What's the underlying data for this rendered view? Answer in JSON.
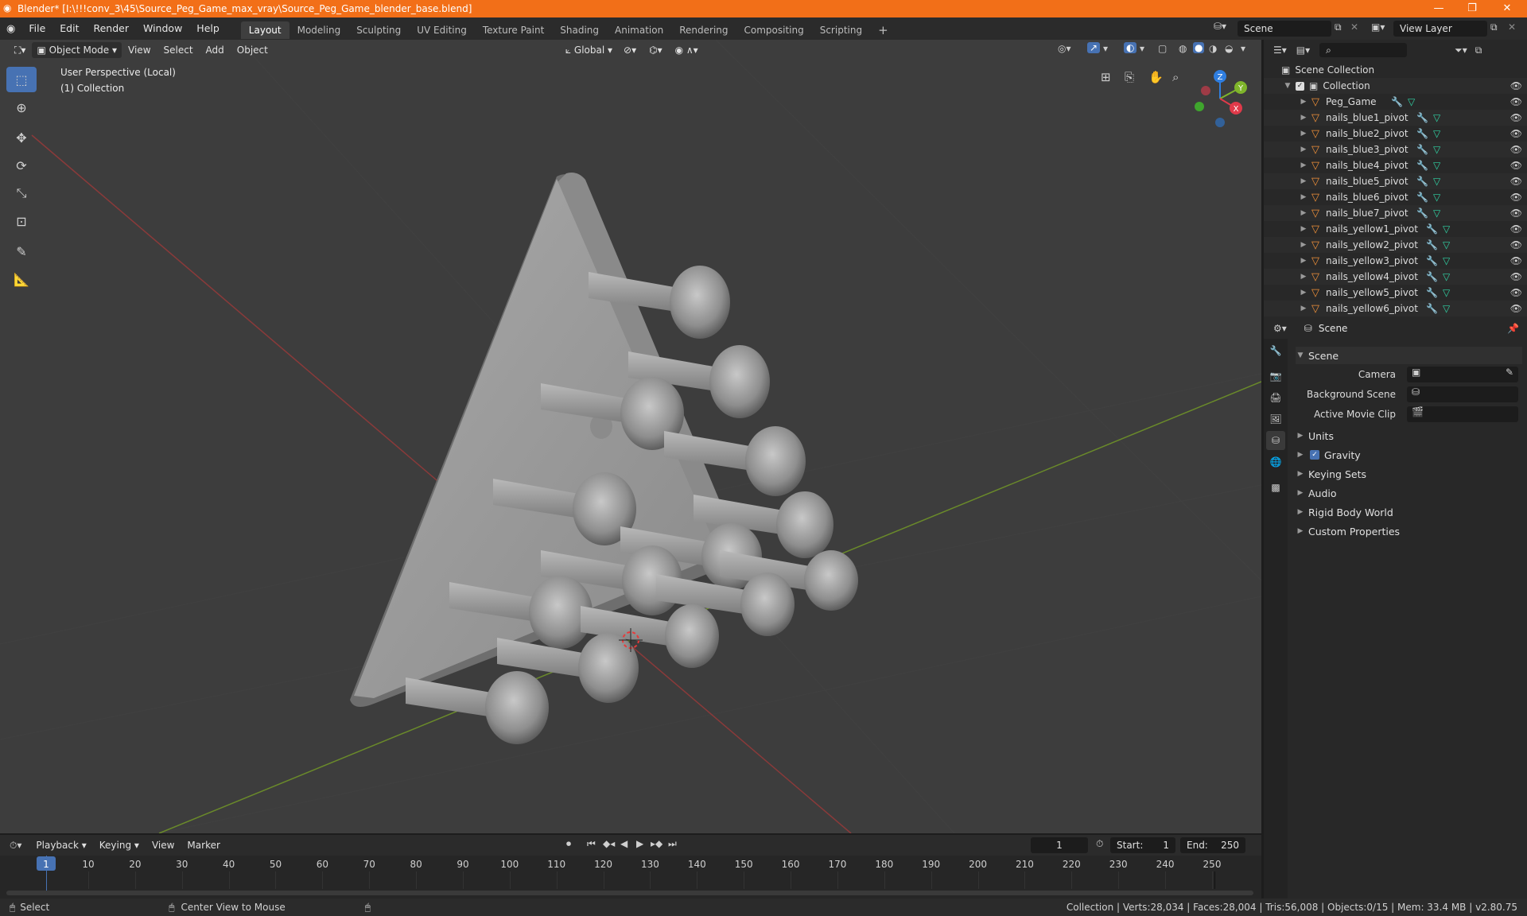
{
  "titlebar": {
    "title": "Blender* [I:\\!!!conv_3\\45\\Source_Peg_Game_max_vray\\Source_Peg_Game_blender_base.blend]",
    "minimize": "—",
    "maximize": "❐",
    "close": "✕"
  },
  "menu": [
    "File",
    "Edit",
    "Render",
    "Window",
    "Help"
  ],
  "workspaces": [
    "Layout",
    "Modeling",
    "Sculpting",
    "UV Editing",
    "Texture Paint",
    "Shading",
    "Animation",
    "Rendering",
    "Compositing",
    "Scripting"
  ],
  "add_workspace": "+",
  "scene_field": "Scene",
  "view_layer_field": "View Layer",
  "viewport": {
    "mode": "Object Mode",
    "menus": [
      "View",
      "Select",
      "Add",
      "Object"
    ],
    "orientation": "Global",
    "perspective_label": "User Perspective (Local)",
    "collection_label": "(1) Collection",
    "gizmo": {
      "x": "X",
      "y": "Y",
      "z": "Z"
    }
  },
  "outliner": {
    "root": "Scene Collection",
    "collection": "Collection",
    "items": [
      "Peg_Game",
      "nails_blue1_pivot",
      "nails_blue2_pivot",
      "nails_blue3_pivot",
      "nails_blue4_pivot",
      "nails_blue5_pivot",
      "nails_blue6_pivot",
      "nails_blue7_pivot",
      "nails_yellow1_pivot",
      "nails_yellow2_pivot",
      "nails_yellow3_pivot",
      "nails_yellow4_pivot",
      "nails_yellow5_pivot",
      "nails_yellow6_pivot"
    ]
  },
  "properties": {
    "context": "Scene",
    "panel_title": "Scene",
    "camera_label": "Camera",
    "background_scene_label": "Background Scene",
    "movie_clip_label": "Active Movie Clip",
    "sections": [
      "Units",
      "Gravity",
      "Keying Sets",
      "Audio",
      "Rigid Body World",
      "Custom Properties"
    ]
  },
  "timeline": {
    "menus": [
      "Playback",
      "Keying",
      "View",
      "Marker"
    ],
    "current_frame": "1",
    "start_label": "Start:",
    "start": "1",
    "end_label": "End:",
    "end": "250",
    "ruler": [
      "1",
      "10",
      "20",
      "30",
      "40",
      "50",
      "60",
      "70",
      "80",
      "90",
      "100",
      "110",
      "120",
      "130",
      "140",
      "150",
      "160",
      "170",
      "180",
      "190",
      "200",
      "210",
      "220",
      "230",
      "240",
      "250"
    ]
  },
  "statusbar": {
    "select": "Select",
    "center_view": "Center View to Mouse",
    "stats": "Collection | Verts:28,034 | Faces:28,004 | Tris:56,008 | Objects:0/15 | Mem: 33.4 MB | v2.80.75"
  },
  "colors": {
    "accent": "#4772b3",
    "titlebar": "#f26f18",
    "object_icon": "#f0913a",
    "mesh_icon": "#31d5a6"
  }
}
